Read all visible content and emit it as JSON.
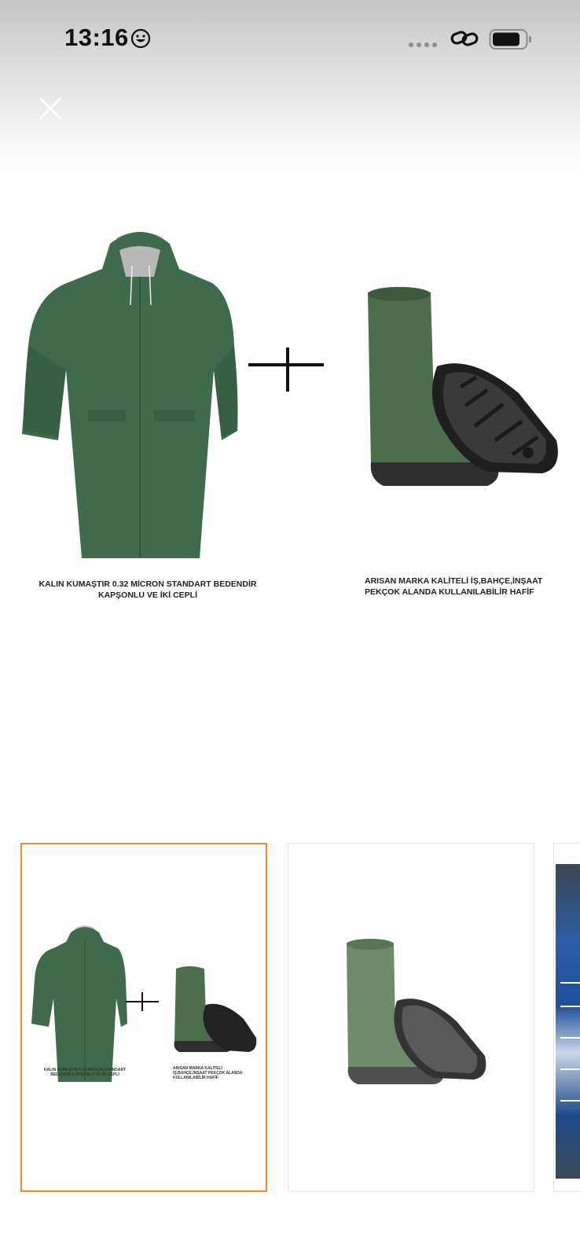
{
  "status_bar": {
    "time": "13:16",
    "emoji_icon": "smiling-face-icon",
    "link_icon": "link-icon",
    "battery_icon": "battery-icon"
  },
  "header": {
    "close_icon": "close-icon"
  },
  "main_image": {
    "captions": {
      "raincoat": "KALIN KUMAŞTIR 0.32 MİCRON STANDART BEDENDİR KAPŞONLU VE İKİ CEPLİ",
      "boots": "ARISAN MARKA KALİTELİ İŞ,BAHÇE,İNŞAAT PEKÇOK ALANDA KULLANILABİLİR HAFİF"
    },
    "colors": {
      "garment": "#3f6b4c",
      "boot": "#4d6e4c",
      "sole": "#2a2a2a"
    }
  },
  "thumbnails": [
    {
      "selected": true,
      "caption_left": "KALIN KUMAŞTIR 0.32 MİCRON STANDART BEDENDİR KAPŞONLU VE İKİ CEPLİ",
      "caption_right": "ARISAN MARKA KALİTELİ İŞ,BAHÇE,İNŞAAT PEKÇOK ALANDA KULLANILABİLİR HAFİF"
    },
    {
      "selected": false
    },
    {
      "selected": false
    }
  ],
  "accent_color": "#ec8a2e"
}
